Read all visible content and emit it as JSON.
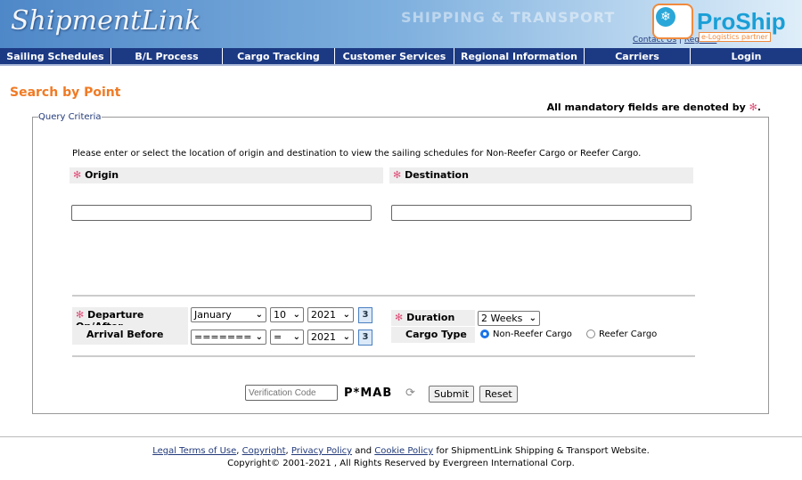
{
  "header": {
    "logo": "ShipmentLink",
    "tagline": "SHIPPING & TRANSPORT",
    "contact": "Contact Us",
    "register": "Regist...",
    "proship": "ProShip",
    "proship_sub": "e-Logistics partner"
  },
  "nav": [
    "Sailing Schedules",
    "B/L Process",
    "Cargo Tracking",
    "Customer Services",
    "Regional Information",
    "Carriers",
    "Login"
  ],
  "page": {
    "title": "Search by Point",
    "mandatory": "All mandatory fields are denoted by",
    "mandatory_end": "."
  },
  "form": {
    "legend": "Query Criteria",
    "instruction": "Please enter or select the location of origin and destination to view the sailing schedules for Non-Reefer Cargo or Reefer Cargo.",
    "origin_label": "Origin",
    "destination_label": "Destination",
    "origin_value": "",
    "destination_value": "",
    "departure_label": "Departure On/After",
    "departure_month": "January",
    "departure_day": "10",
    "departure_year": "2021",
    "arrival_label": "Arrival Before",
    "arrival_month": "=======",
    "arrival_day": "=",
    "arrival_year": "2021",
    "calendar_icon": "3",
    "duration_label": "Duration",
    "duration_value": "2 Weeks",
    "cargo_label": "Cargo Type",
    "cargo_options": [
      "Non-Reefer Cargo",
      "Reefer Cargo"
    ],
    "cargo_selected": "Non-Reefer Cargo",
    "verification_placeholder": "Verification Code",
    "captcha": "P*MAB",
    "submit": "Submit",
    "reset": "Reset"
  },
  "footer": {
    "links": [
      "Legal Terms of Use",
      "Copyright",
      "Privacy Policy",
      "Cookie Policy"
    ],
    "and": "and",
    "suffix": "for ShipmentLink Shipping & Transport Website.",
    "copyright": "Copyright© 2001-2021 , All Rights Reserved by Evergreen International Corp."
  }
}
